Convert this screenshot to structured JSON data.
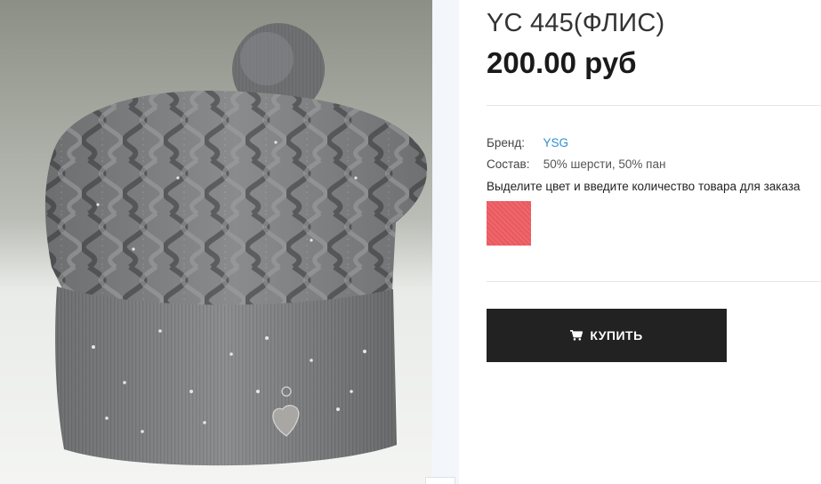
{
  "product": {
    "title": "YC 445(ФЛИС)",
    "price": "200.00 руб",
    "image_alt": "grey knitted hat with pompom"
  },
  "attributes": {
    "brand_label": "Бренд:",
    "brand_value": "YSG",
    "composition_label": "Состав:",
    "composition_value": "50% шерсти, 50% пан"
  },
  "order": {
    "hint": "Выделите цвет и введите количество товара для заказа",
    "color_swatches": [
      {
        "color": "#f05e64"
      }
    ]
  },
  "buy": {
    "label": "КУПИТЬ",
    "icon": "cart-icon"
  },
  "colors": {
    "button_bg": "#222222",
    "link": "#2f8fd6",
    "swatch": "#f05e64"
  }
}
